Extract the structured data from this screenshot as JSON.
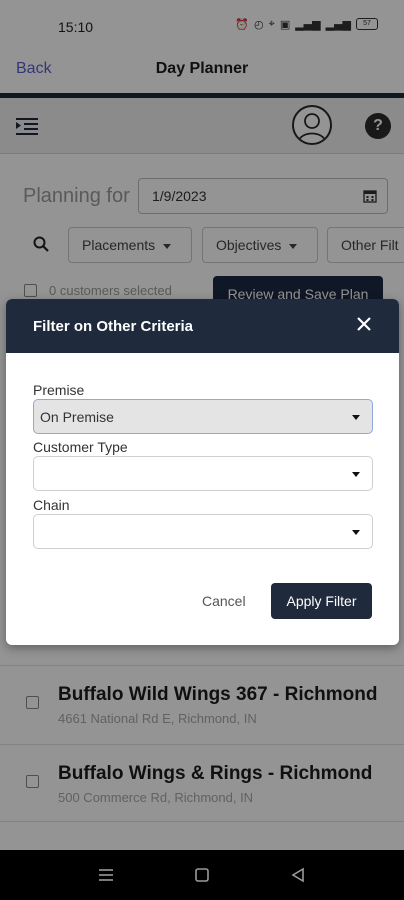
{
  "status_bar": {
    "time": "15:10",
    "icons": [
      "alarm-icon",
      "clock-icon",
      "location-icon",
      "nfc-icon",
      "signal-icon",
      "signal-icon",
      "battery-icon"
    ],
    "battery_level": "57"
  },
  "header": {
    "back_label": "Back",
    "title": "Day Planner",
    "accent_color": "#5b5fc7",
    "bar_color": "#1f2a3d"
  },
  "toolbar": {
    "help_label": "?"
  },
  "planner": {
    "planning_label": "Planning for",
    "date_value": "1/9/2023",
    "filters": [
      "Placements",
      "Objectives",
      "Other Filt"
    ],
    "selected_text": "0 customers selected",
    "review_label": "Review and Save Plan"
  },
  "customers": [
    {
      "name": "Buffalo Wild Wings 367 - Richmond",
      "address": "4661 National Rd E, Richmond, IN"
    },
    {
      "name": "Buffalo Wings & Rings - Richmond",
      "address": "500 Commerce Rd, Richmond, IN"
    }
  ],
  "modal": {
    "title": "Filter on Other Criteria",
    "fields": [
      {
        "label": "Premise",
        "value": "On Premise"
      },
      {
        "label": "Customer Type",
        "value": ""
      },
      {
        "label": "Chain",
        "value": ""
      }
    ],
    "cancel_label": "Cancel",
    "apply_label": "Apply Filter"
  }
}
